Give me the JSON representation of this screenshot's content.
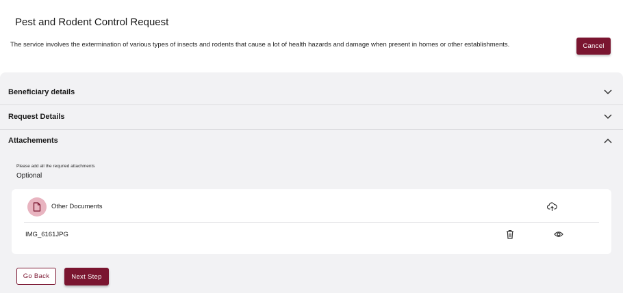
{
  "header": {
    "title": "Pest and Rodent Control Request",
    "description": "The service involves the extermination of various types of insects and rodents that cause a lot of health hazards and damage when present in homes or other establishments.",
    "cancel_label": "Cancel"
  },
  "accordion": [
    {
      "title": "Beneficiary details",
      "state": "collapsed",
      "icon": "chevron-down-icon"
    },
    {
      "title": "Request Details",
      "state": "collapsed",
      "icon": "chevron-down-icon"
    },
    {
      "title": "Attachements",
      "state": "expanded",
      "icon": "chevron-up-icon"
    }
  ],
  "attachments": {
    "hint": "Please add all the requried attachments",
    "optional_label": "Optional",
    "document": {
      "label": "Other Documents",
      "icon": "document-icon",
      "upload_icon": "upload-cloud-icon",
      "file": {
        "name": "IMG_6161JPG",
        "delete_icon": "trash-icon",
        "view_icon": "eye-icon"
      }
    }
  },
  "footer": {
    "back_label": "Go Back",
    "next_label": "Next Step"
  },
  "colors": {
    "brand": "#7a1530",
    "panel": "#f2f2f4",
    "doc_circle": "#e8b4c0"
  }
}
